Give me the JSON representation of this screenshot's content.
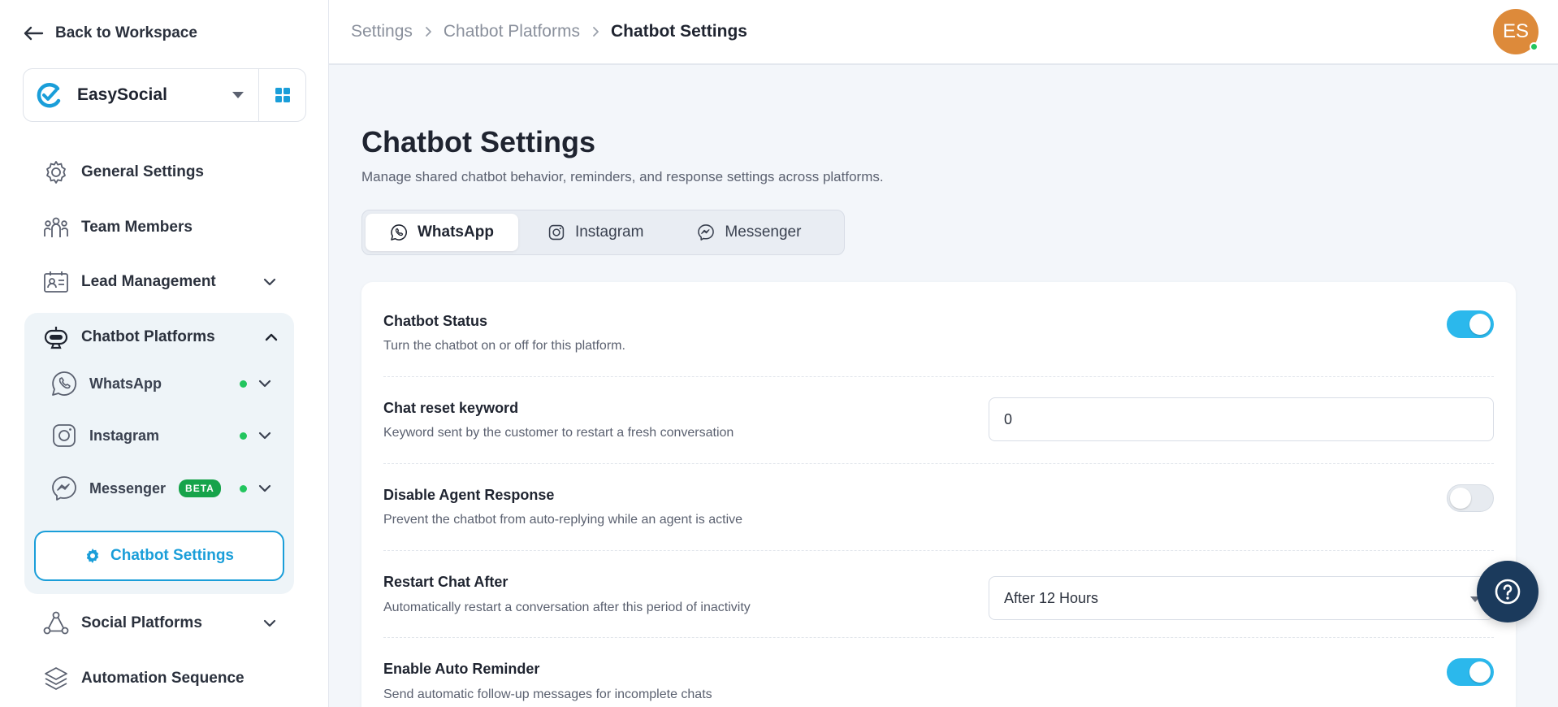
{
  "sidebar": {
    "back_label": "Back to Workspace",
    "workspace": {
      "name": "EasySocial"
    },
    "nav": {
      "general": "General Settings",
      "team": "Team Members",
      "lead": "Lead Management",
      "chatbot": "Chatbot Platforms",
      "social": "Social Platforms",
      "automation": "Automation Sequence"
    },
    "chatbot_sub": {
      "whatsapp": "WhatsApp",
      "instagram": "Instagram",
      "messenger": "Messenger",
      "messenger_badge": "BETA",
      "settings": "Chatbot Settings"
    }
  },
  "header": {
    "breadcrumb": [
      "Settings",
      "Chatbot Platforms",
      "Chatbot Settings"
    ],
    "avatar_initials": "ES"
  },
  "main": {
    "title": "Chatbot Settings",
    "subtitle": "Manage shared chatbot behavior, reminders, and response settings across platforms.",
    "tabs": [
      "WhatsApp",
      "Instagram",
      "Messenger"
    ],
    "active_tab": "WhatsApp",
    "settings": {
      "status": {
        "title": "Chatbot Status",
        "desc": "Turn the chatbot on or off for this platform.",
        "enabled": true
      },
      "reset": {
        "title": "Chat reset keyword",
        "desc": "Keyword sent by the customer to restart a fresh conversation",
        "value": "0"
      },
      "disable_agent": {
        "title": "Disable Agent Response",
        "desc": "Prevent the chatbot from auto-replying while an agent is active",
        "enabled": false
      },
      "restart": {
        "title": "Restart Chat After",
        "desc": "Automatically restart a conversation after this period of inactivity",
        "value": "After 12 Hours"
      },
      "reminder": {
        "title": "Enable Auto Reminder",
        "desc": "Send automatic follow-up messages for incomplete chats",
        "enabled": true
      }
    }
  },
  "colors": {
    "accent": "#1a9ed9",
    "toggle_on": "#2bb8ec",
    "online": "#22c55e",
    "avatar": "#dd8a3a",
    "help": "#1b3a5c"
  },
  "icons": {
    "back": "arrow-left-icon",
    "logo": "easysocial-logo-icon",
    "grid": "grid-icon",
    "general": "gear-icon",
    "team": "team-icon",
    "lead": "contact-card-icon",
    "chatbot": "robot-icon",
    "whatsapp": "whatsapp-icon",
    "instagram": "instagram-icon",
    "messenger": "messenger-icon",
    "social": "share-nodes-icon",
    "automation": "layers-icon",
    "help": "question-icon"
  }
}
